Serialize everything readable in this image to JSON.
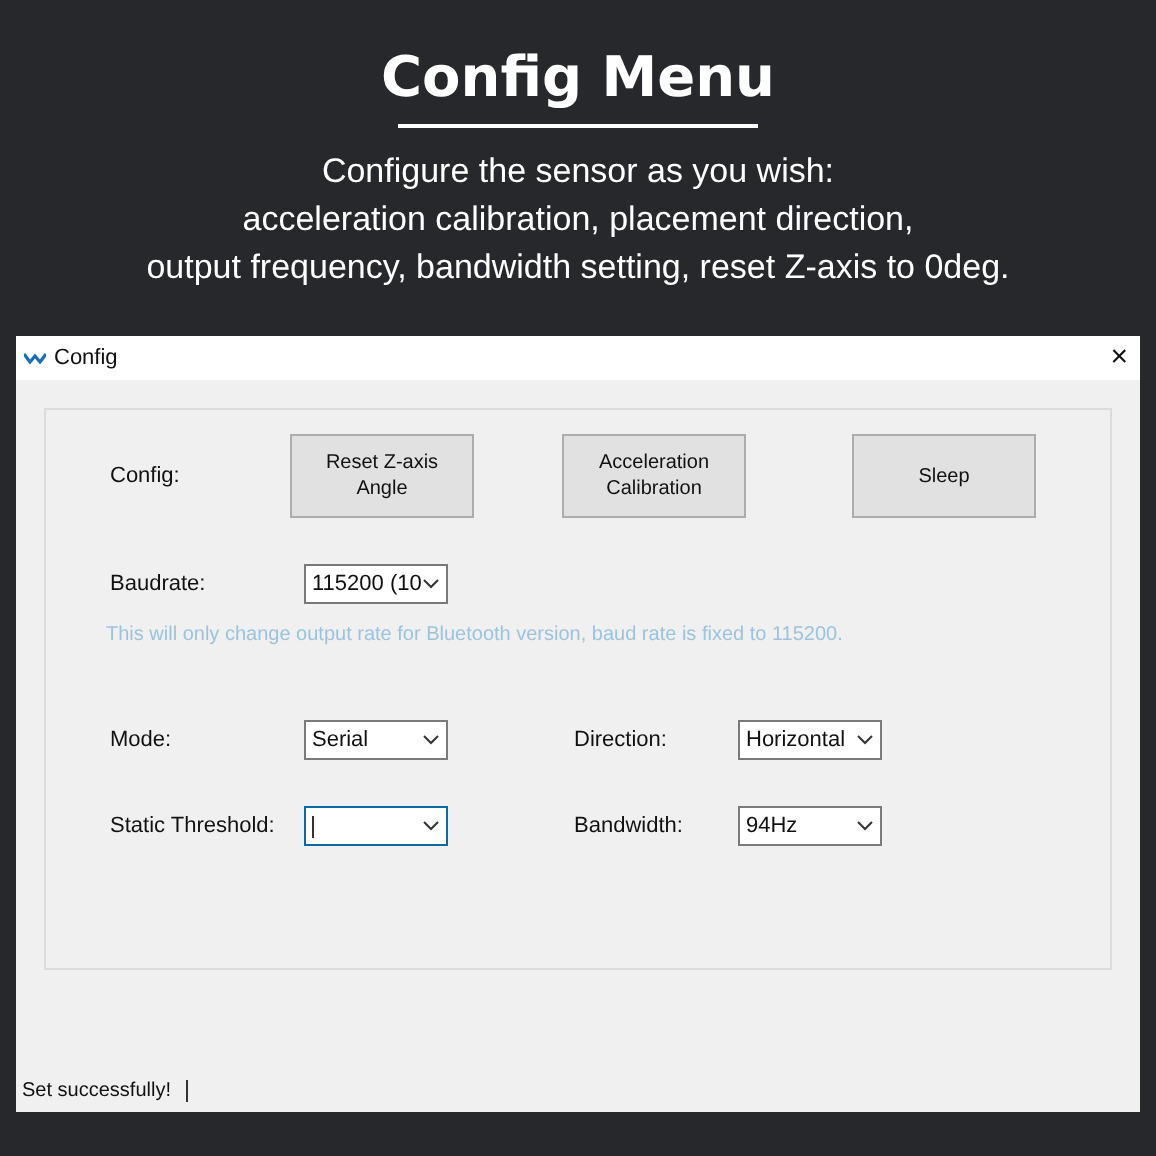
{
  "header": {
    "title": "Config Menu",
    "subtitle_lines": [
      "Configure the sensor as you wish:",
      "acceleration calibration, placement direction,",
      "output frequency, bandwidth setting, reset Z-axis to 0deg."
    ]
  },
  "window": {
    "title": "Config",
    "close": "×"
  },
  "config": {
    "label": "Config:",
    "buttons": [
      {
        "lines": [
          "Reset Z-axis",
          "Angle"
        ]
      },
      {
        "lines": [
          "Acceleration",
          "Calibration"
        ]
      },
      {
        "lines": [
          "Sleep"
        ]
      }
    ]
  },
  "baudrate": {
    "label": "Baudrate:",
    "value": "115200 (10"
  },
  "note": "This will only change output rate for Bluetooth version, baud rate is fixed to 115200.",
  "fields": [
    {
      "label": "Mode:",
      "value": "Serial",
      "focused": false
    },
    {
      "label": "Direction:",
      "value": "Horizontal",
      "focused": false
    },
    {
      "label": "Static Threshold:",
      "focused": true
    },
    {
      "label": "Bandwidth:",
      "value": "94Hz",
      "focused": false
    }
  ],
  "status": "Set successfully!"
}
